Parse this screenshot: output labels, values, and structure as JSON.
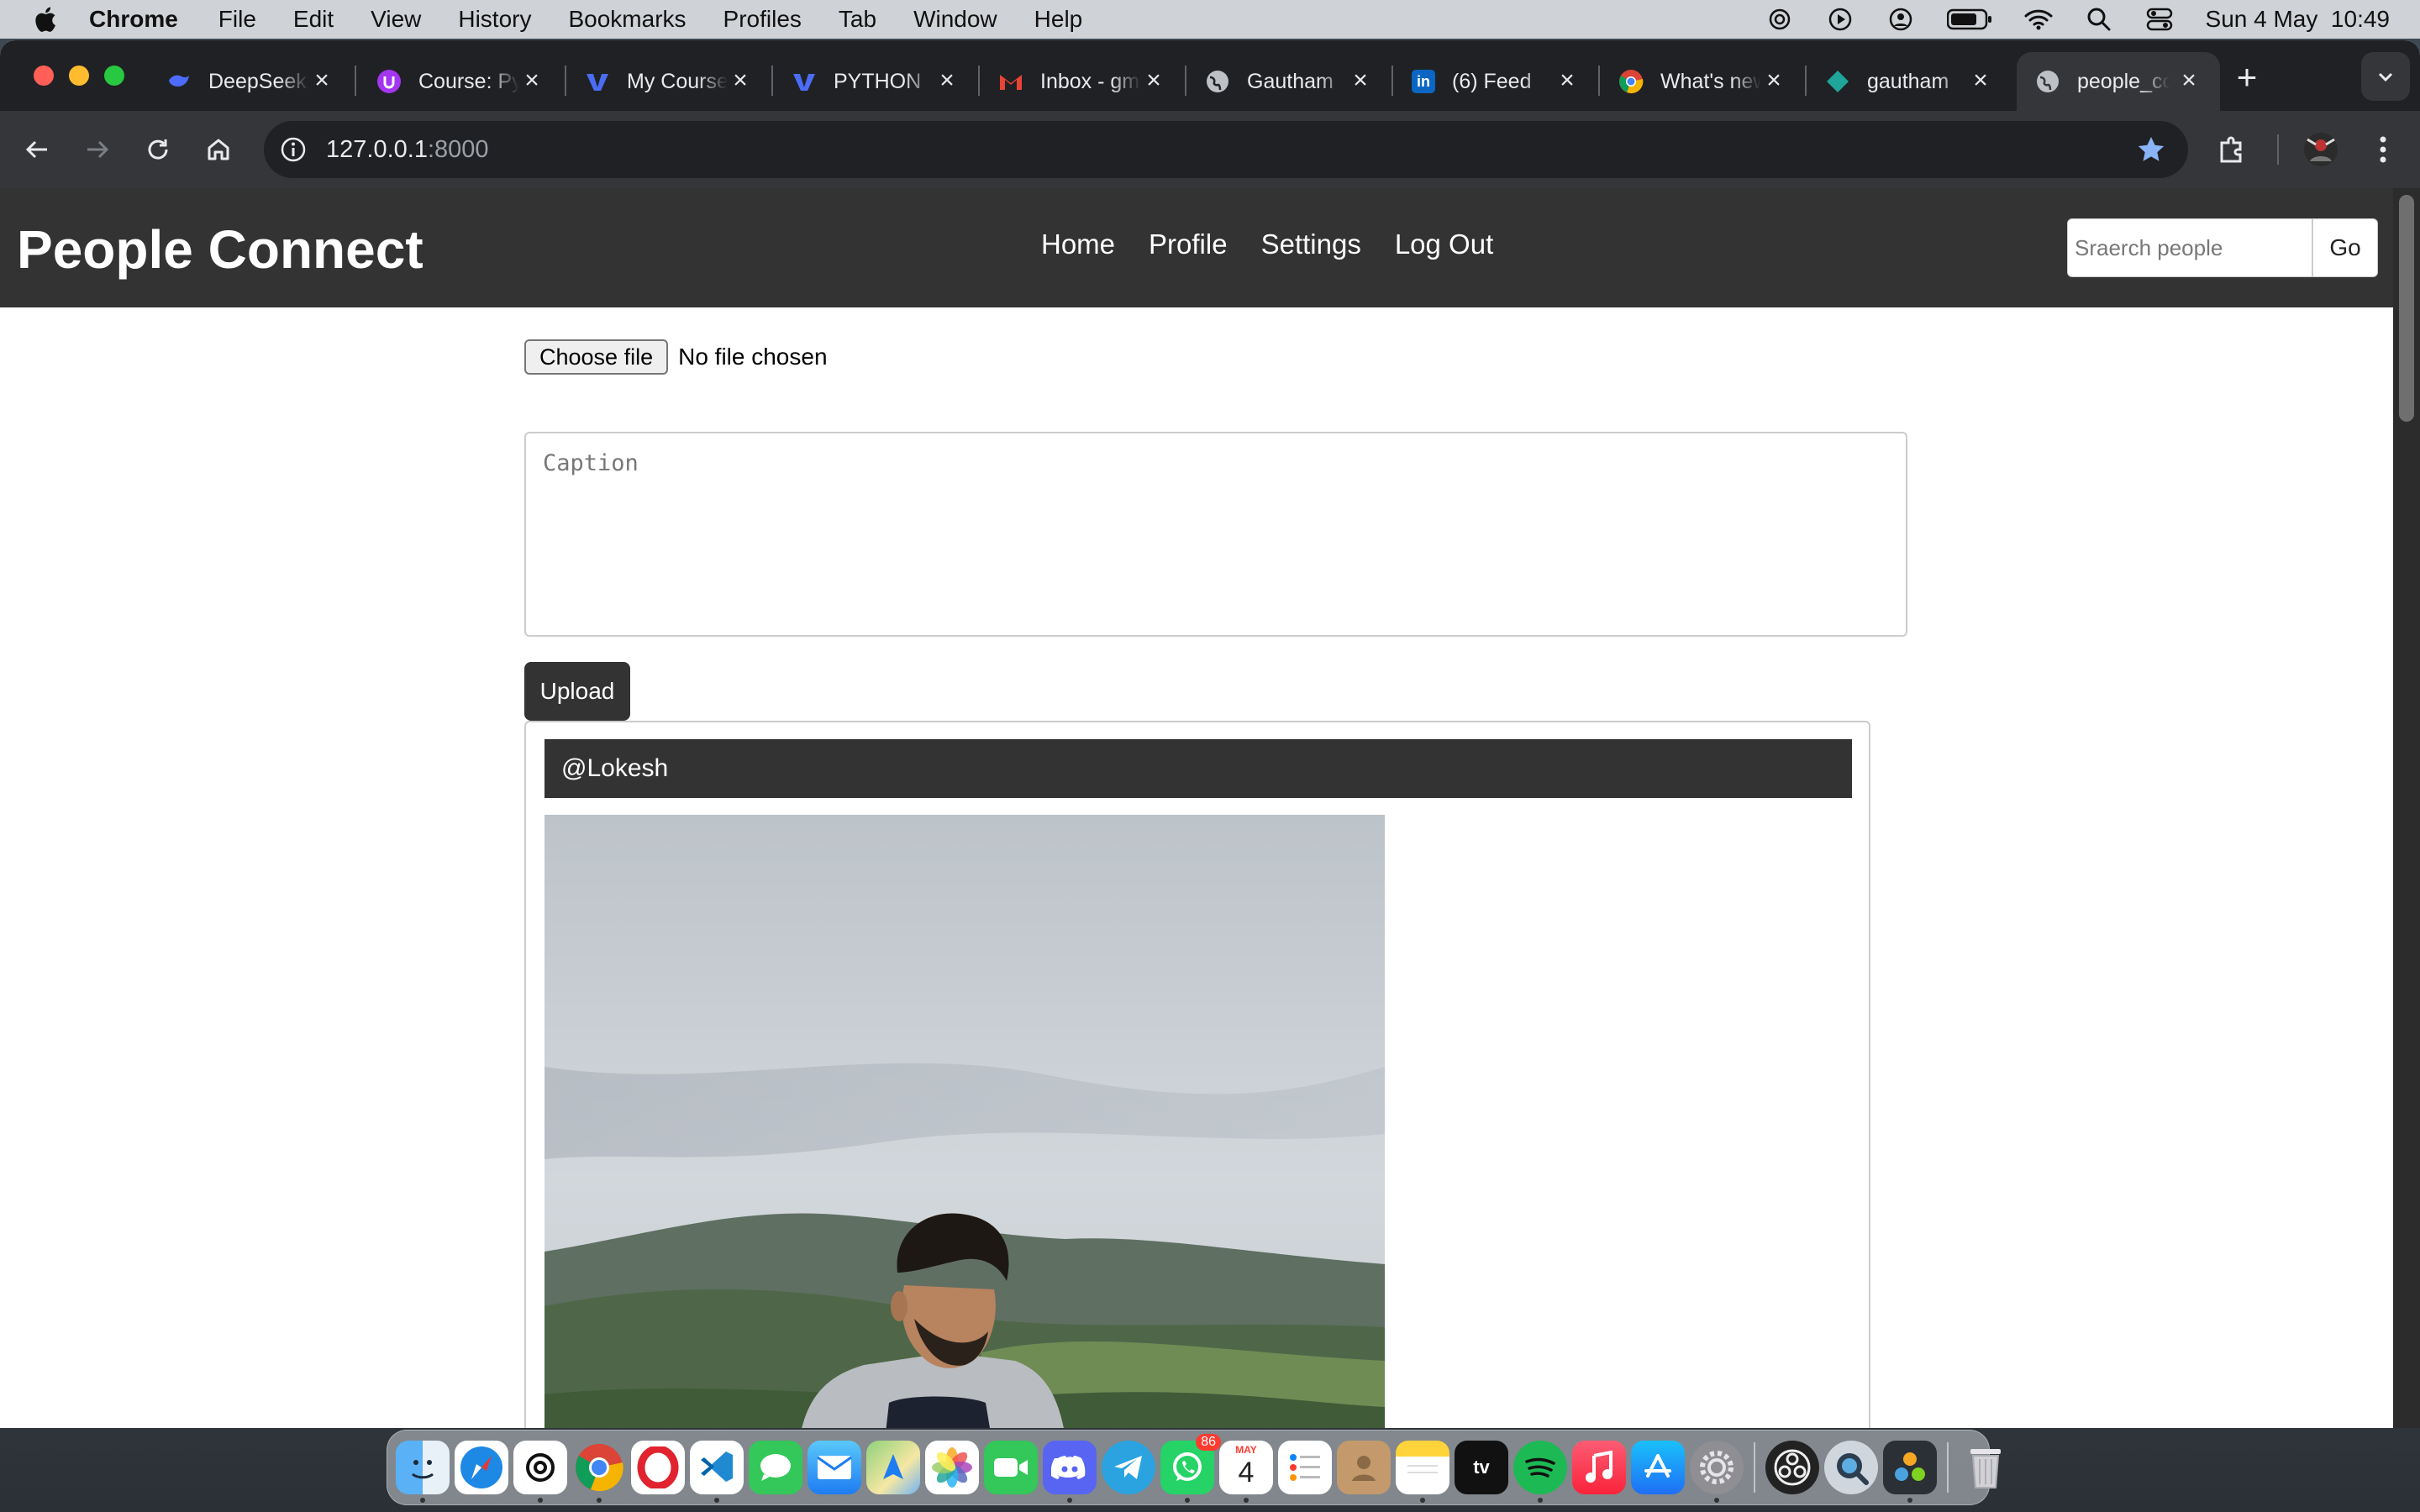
{
  "menubar": {
    "app": "Chrome",
    "items": [
      "File",
      "Edit",
      "View",
      "History",
      "Bookmarks",
      "Profiles",
      "Tab",
      "Window",
      "Help"
    ],
    "datetime": "Sun 4 May  10:49"
  },
  "tabs": [
    {
      "title": "DeepSeek",
      "icon": "deepseek-icon"
    },
    {
      "title": "Course: Python",
      "icon": "course-icon"
    },
    {
      "title": "My Courses",
      "icon": "courses-icon"
    },
    {
      "title": "PYTHON",
      "icon": "python-course-icon"
    },
    {
      "title": "Inbox - gmail",
      "icon": "gmail-icon"
    },
    {
      "title": "Gautham",
      "icon": "globe-icon"
    },
    {
      "title": "(6) Feed",
      "icon": "linkedin-icon"
    },
    {
      "title": "What's new",
      "icon": "chrome-icon"
    },
    {
      "title": "gautham",
      "icon": "diamond-icon"
    },
    {
      "title": "people_connect",
      "icon": "globe-icon",
      "active": true
    }
  ],
  "address": {
    "host": "127.0.0.1",
    "port": ":8000"
  },
  "site": {
    "brand": "People Connect",
    "nav": {
      "home": "Home",
      "profile": "Profile",
      "settings": "Settings",
      "logout": "Log Out"
    },
    "search_placeholder": "Sraerch people",
    "go_label": "Go"
  },
  "upload_form": {
    "choose_file": "Choose file",
    "no_file": "No file chosen",
    "caption_placeholder": "Caption",
    "upload_label": "Upload"
  },
  "post": {
    "username": "@Lokesh"
  },
  "dock": {
    "calendar_month": "MAY",
    "calendar_day": "4",
    "whatsapp_badge": "86"
  },
  "colors": {
    "site_nav": "#333333",
    "chrome_frame": "#202124",
    "chrome_toolbar": "#35363a",
    "star": "#8ab4f8"
  }
}
